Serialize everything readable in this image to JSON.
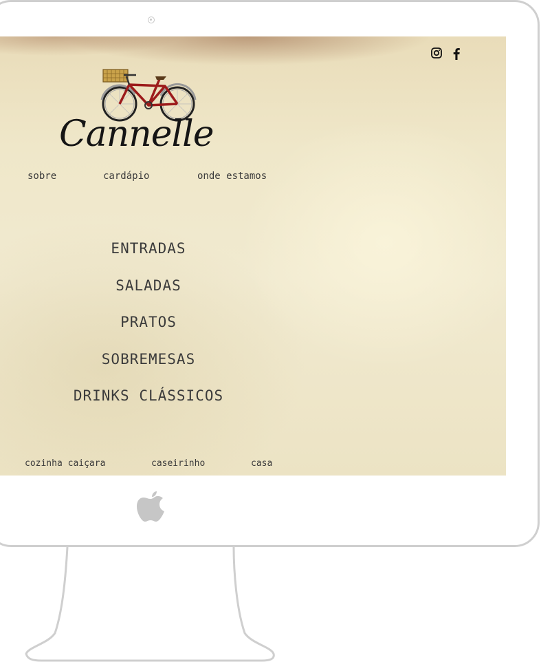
{
  "site": {
    "brand": "Cannelle",
    "nav": [
      "sobre",
      "cardápio",
      "onde estamos"
    ],
    "menu": [
      "ENTRADAS",
      "SALADAS",
      "PRATOS",
      "SOBREMESAS",
      "DRINKS CLÁSSICOS"
    ],
    "footer_nav": [
      "cozinha caiçara",
      "caseirinho",
      "casa"
    ],
    "social": [
      "instagram-icon",
      "facebook-icon"
    ]
  },
  "colors": {
    "paper": "#efe7c9",
    "text": "#3b3b3b",
    "bike_frame": "#9c1b1b",
    "monitor_bezel": "#cfcfcf"
  }
}
